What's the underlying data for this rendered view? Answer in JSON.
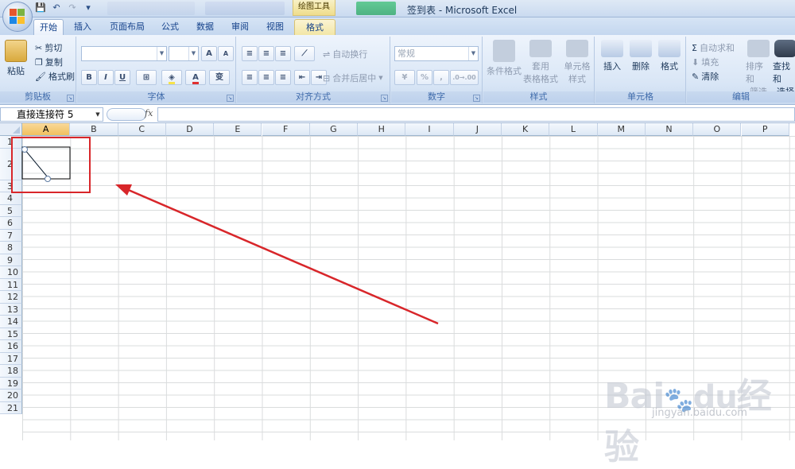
{
  "window": {
    "title": "签到表 - Microsoft Excel",
    "contextual_group": "绘图工具"
  },
  "tabs": [
    {
      "label": "开始",
      "active": true
    },
    {
      "label": "插入"
    },
    {
      "label": "页面布局"
    },
    {
      "label": "公式"
    },
    {
      "label": "数据"
    },
    {
      "label": "审阅"
    },
    {
      "label": "视图"
    },
    {
      "label": "格式",
      "contextual": true
    }
  ],
  "ribbon": {
    "clipboard": {
      "label": "剪贴板",
      "paste": "粘贴",
      "cut": "剪切",
      "copy": "复制",
      "format_painter": "格式刷"
    },
    "font": {
      "label": "字体",
      "bold": "B",
      "italic": "I",
      "underline": "U",
      "grow": "A",
      "shrink": "A",
      "phonetic": "变"
    },
    "alignment": {
      "label": "对齐方式",
      "wrap": "自动换行",
      "merge": "合并后居中"
    },
    "number": {
      "label": "数字",
      "format": "常规",
      "percent": "%",
      "comma": ",",
      "inc_dec": ".0→.00"
    },
    "styles": {
      "label": "样式",
      "conditional": "条件格式",
      "table_format_1": "套用",
      "table_format_2": "表格格式",
      "cell_styles_1": "单元格",
      "cell_styles_2": "样式"
    },
    "cells": {
      "label": "单元格",
      "insert": "插入",
      "delete": "删除",
      "format": "格式"
    },
    "editing": {
      "label": "编辑",
      "autosum": "自动求和",
      "fill": "填充",
      "clear": "清除",
      "sort_1": "排序和",
      "sort_2": "筛选",
      "find_1": "查找和",
      "find_2": "选择"
    }
  },
  "formula_bar": {
    "name_box": "直接连接符 5",
    "fx": "fx",
    "formula": ""
  },
  "columns": [
    "A",
    "B",
    "C",
    "D",
    "E",
    "F",
    "G",
    "H",
    "I",
    "J",
    "K",
    "L",
    "M",
    "N",
    "O",
    "P"
  ],
  "rows": [
    "1",
    "2",
    "3",
    "4",
    "5",
    "6",
    "7",
    "8",
    "9",
    "10",
    "11",
    "12",
    "13",
    "14",
    "15",
    "16",
    "17",
    "18",
    "19",
    "20",
    "21"
  ],
  "selected_column": "A",
  "annotation": {
    "color": "#d8262a"
  },
  "watermark": {
    "brand": "Bai",
    "brand_du": "du",
    "text": "经验",
    "sub": "jingyan.baidu.com"
  }
}
